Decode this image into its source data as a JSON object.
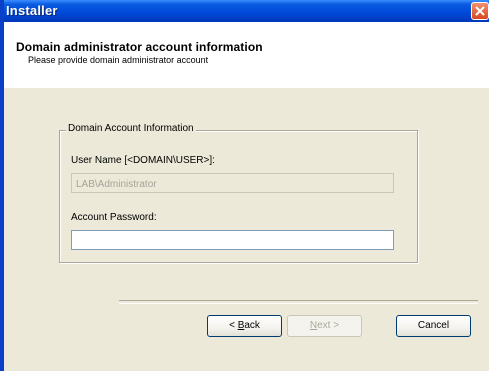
{
  "window": {
    "title": "Installer",
    "close_icon": "close-icon"
  },
  "header": {
    "title": "Domain administrator account information",
    "subtitle": "Please provide domain administrator account"
  },
  "group": {
    "legend": "Domain Account Information",
    "username_label": "User Name [<DOMAIN\\USER>]:",
    "username_value": "LAB\\Administrator",
    "password_label": "Account Password:",
    "password_value": ""
  },
  "buttons": {
    "back": {
      "prefix": "< ",
      "mnemonic": "B",
      "rest": "ack"
    },
    "next": {
      "mnemonic": "N",
      "rest": "ext >"
    },
    "cancel": "Cancel"
  }
}
